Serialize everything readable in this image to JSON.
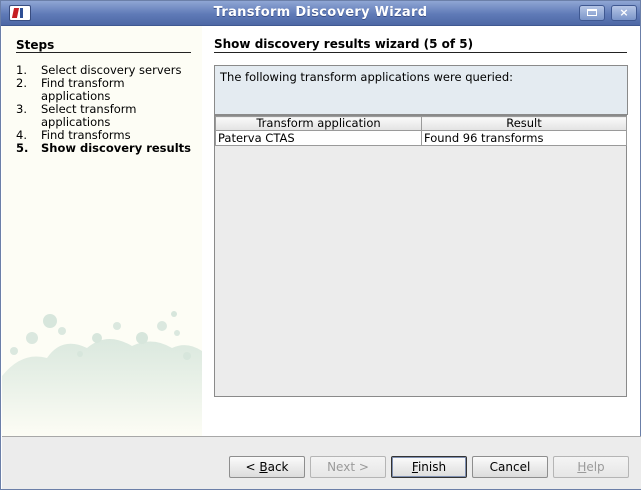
{
  "window": {
    "title": "Transform Discovery Wizard",
    "minimize_icon": "minimize-icon",
    "close_icon": "close-icon",
    "close_glyph": "×"
  },
  "steps": {
    "title": "Steps",
    "items": [
      {
        "num": "1.",
        "label": "Select discovery servers"
      },
      {
        "num": "2.",
        "label": "Find transform applications"
      },
      {
        "num": "3.",
        "label": "Select transform applications"
      },
      {
        "num": "4.",
        "label": "Find transforms"
      },
      {
        "num": "5.",
        "label": "Show discovery results",
        "current": true
      }
    ]
  },
  "content": {
    "title": "Show discovery results wizard (5 of 5)",
    "info": "The following transform applications were queried:",
    "table": {
      "headers": [
        "Transform application",
        "Result"
      ],
      "rows": [
        [
          "Paterva CTAS",
          "Found 96 transforms"
        ]
      ]
    }
  },
  "buttons": {
    "back": {
      "prefix": "< ",
      "mnemonic": "B",
      "rest": "ack",
      "enabled": true
    },
    "next": {
      "label": "Next >",
      "enabled": false
    },
    "finish": {
      "mnemonic": "F",
      "rest": "inish",
      "enabled": true,
      "default": true
    },
    "cancel": {
      "label": "Cancel",
      "enabled": true
    },
    "help": {
      "mnemonic": "H",
      "rest": "elp",
      "enabled": false
    }
  },
  "colors": {
    "titlebar": "#5f7ab7",
    "steps_bg": "#fdfdf5",
    "info_bg": "#e4ebf1",
    "bubble": "#d7e6dc"
  }
}
